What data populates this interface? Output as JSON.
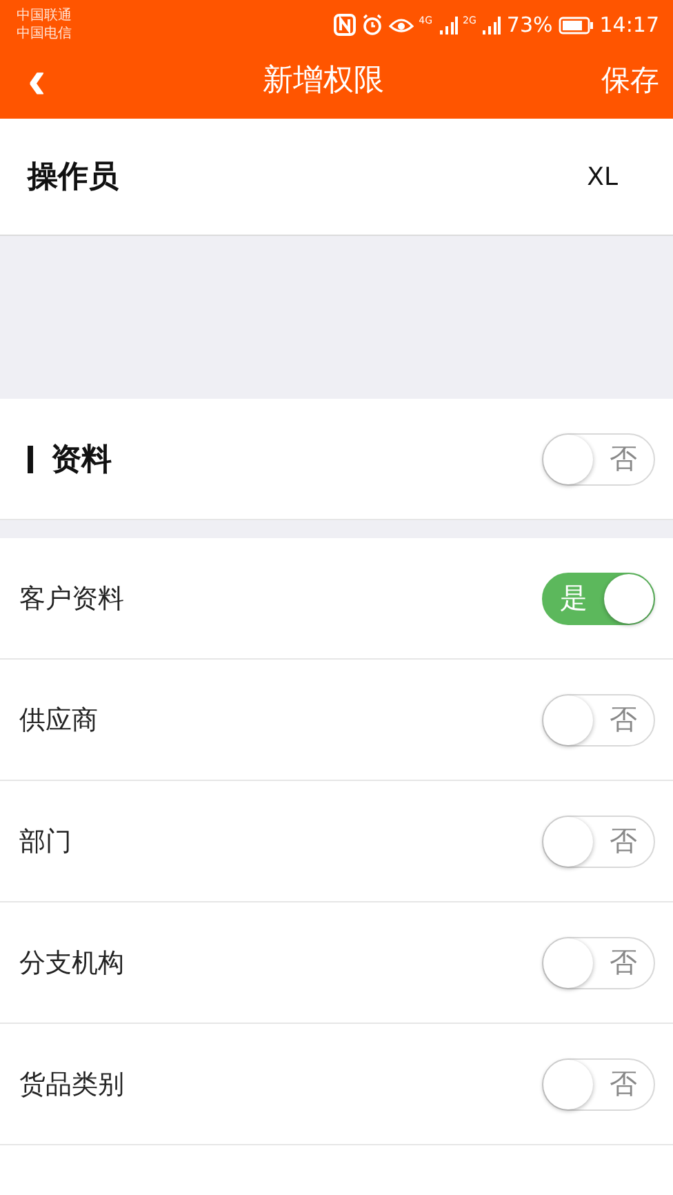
{
  "status_bar": {
    "carriers": [
      "中国联通",
      "中国电信"
    ],
    "network_1": "4G",
    "network_2": "2G",
    "battery": "73%",
    "time": "14:17"
  },
  "header": {
    "back": "‹",
    "title": "新增权限",
    "action": "保存"
  },
  "operator": {
    "label": "操作员",
    "value": "XL"
  },
  "section": {
    "title": "资料",
    "toggle": {
      "on": false,
      "text": "否"
    }
  },
  "permissions": [
    {
      "label": "客户资料",
      "on": true,
      "text": "是"
    },
    {
      "label": "供应商",
      "on": false,
      "text": "否"
    },
    {
      "label": "部门",
      "on": false,
      "text": "否"
    },
    {
      "label": "分支机构",
      "on": false,
      "text": "否"
    },
    {
      "label": "货品类别",
      "on": false,
      "text": "否"
    }
  ]
}
